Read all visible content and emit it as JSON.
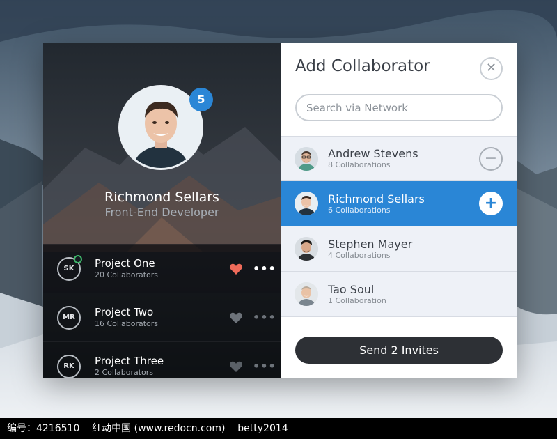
{
  "profile": {
    "name": "Richmond Sellars",
    "role": "Front-End Developer",
    "badge_count": "5"
  },
  "projects": [
    {
      "initials": "SK",
      "title": "Project One",
      "subtitle": "20 Collaborators",
      "liked": true,
      "online": true
    },
    {
      "initials": "MR",
      "title": "Project Two",
      "subtitle": "16 Collaborators",
      "liked": false,
      "online": false
    },
    {
      "initials": "RK",
      "title": "Project Three",
      "subtitle": "2 Collaborators",
      "liked": false,
      "online": false
    }
  ],
  "collaborator_panel": {
    "title": "Add Collaborator",
    "close_icon": "close-icon",
    "search_placeholder": "Search via Network"
  },
  "people": [
    {
      "name": "Andrew Stevens",
      "subtitle": "8 Collaborations",
      "action": "remove",
      "selected": false
    },
    {
      "name": "Richmond Sellars",
      "subtitle": "6 Collaborations",
      "action": "add",
      "selected": true
    },
    {
      "name": "Stephen Mayer",
      "subtitle": "4 Collaborations",
      "action": "none",
      "selected": false
    },
    {
      "name": "Tao Soul",
      "subtitle": "1 Collaboration",
      "action": "none",
      "selected": false
    }
  ],
  "send_button_label": "Send 2 Invites",
  "watermark": "编号：4216510    红动中国 (www.redocn.com)    betty2014",
  "colors": {
    "accent": "#2a86d6",
    "heart_active": "#ef6b5a",
    "online": "#3fb86b",
    "dark_button": "#2d3035"
  }
}
